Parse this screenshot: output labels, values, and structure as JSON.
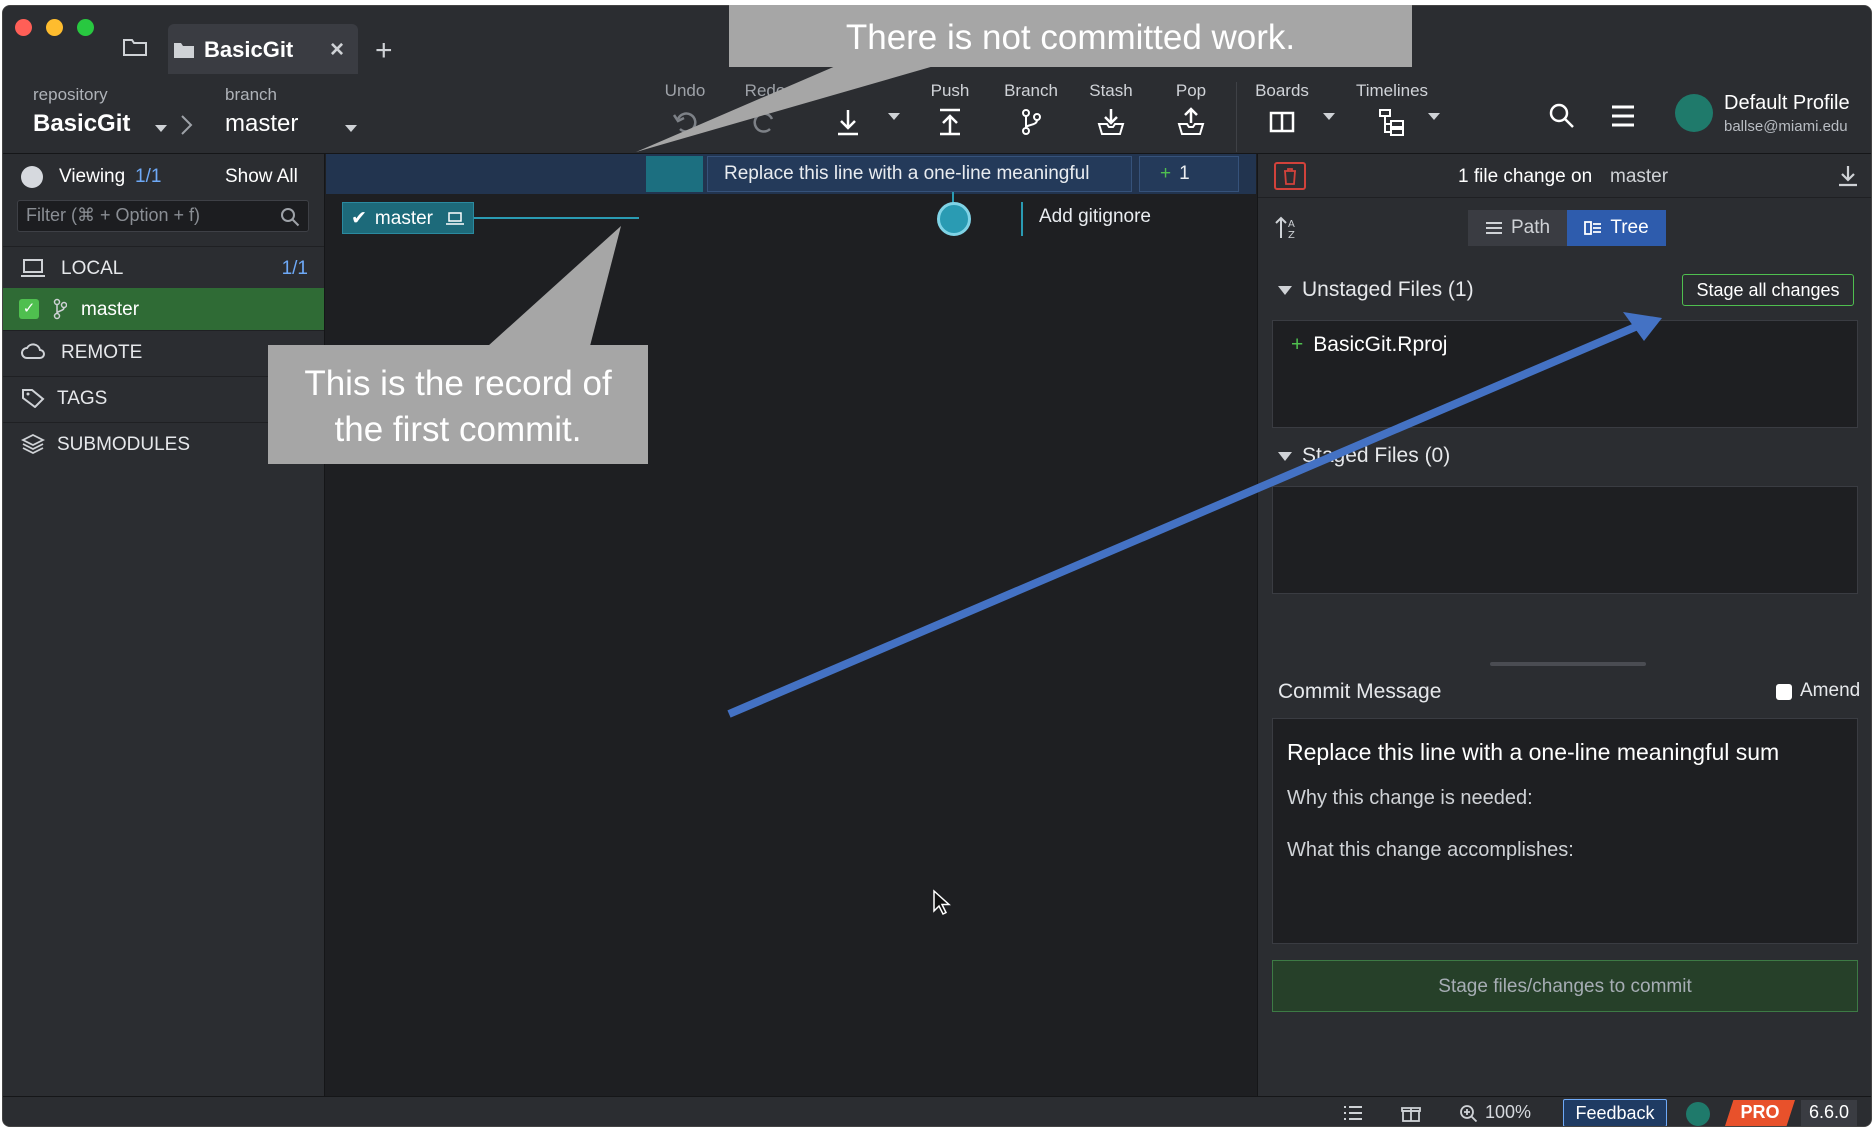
{
  "tab": {
    "title": "BasicGit",
    "close": "×",
    "add": "+"
  },
  "toolbar": {
    "repository_label": "repository",
    "repository_value": "BasicGit",
    "branch_label": "branch",
    "branch_value": "master",
    "undo": "Undo",
    "redo": "Redo",
    "push": "Push",
    "branch": "Branch",
    "stash": "Stash",
    "pop": "Pop",
    "boards": "Boards",
    "timelines": "Timelines"
  },
  "profile": {
    "name": "Default Profile",
    "email": "ballse@miami.edu"
  },
  "left": {
    "viewing_label": "Viewing",
    "viewing_count": "1/1",
    "show_all": "Show All",
    "filter_placeholder": "Filter (⌘ + Option + f)",
    "local": "LOCAL",
    "local_count": "1/1",
    "master": "master",
    "remote": "REMOTE",
    "tags": "TAGS",
    "submodules": "SUBMODULES"
  },
  "graph": {
    "wip_message": "Replace this line with a one-line meaningful",
    "wip_count": "1",
    "branch_tag": "master",
    "commit_message": "Add gitignore"
  },
  "right": {
    "header_title": "1 file change on",
    "header_branch": "master",
    "view_path": "Path",
    "view_tree": "Tree",
    "unstaged_label": "Unstaged Files (1)",
    "stage_all": "Stage all changes",
    "unstaged_file": "BasicGit.Rproj",
    "staged_label": "Staged Files (0)",
    "commit_message_label": "Commit Message",
    "amend_label": "Amend",
    "summary": "Replace this line with a one-line meaningful sum",
    "body_line1": "Why this change is needed:",
    "body_line2": "What this change accomplishes:",
    "commit_button": "Stage files/changes to commit"
  },
  "status": {
    "zoom": "100%",
    "feedback": "Feedback",
    "pro": "PRO",
    "version": "6.6.0"
  },
  "callouts": {
    "top": "There is not committed work.",
    "bottom_line1": "This is the record of",
    "bottom_line2": "the first commit."
  },
  "colors": {
    "accent_teal": "#2a9bb3",
    "stage_green": "#4fbf4f",
    "arrow_blue": "#4472c4",
    "callout_gray": "#a6a6a6"
  }
}
